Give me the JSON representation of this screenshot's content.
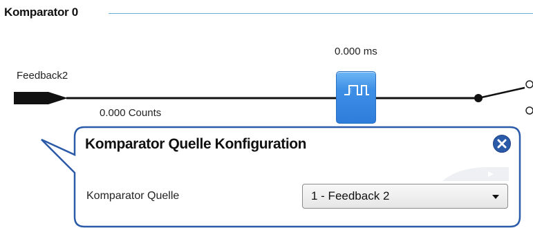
{
  "section": {
    "title": "Komparator 0"
  },
  "diagram": {
    "timing_value": "0.000 ms",
    "signal_label": "Feedback2",
    "counts_value": "0.000 Counts",
    "block_icon": "pulse-waveform-icon",
    "switch_icon": "switch-icon"
  },
  "popup": {
    "title": "Komparator Quelle Konfiguration",
    "close_icon": "close-icon",
    "field_label": "Komparator Quelle",
    "select_value": "1 - Feedback 2",
    "select_arrow_icon": "chevron-down-icon"
  },
  "colors": {
    "accent_blue": "#3d8fe6",
    "popup_border": "#2a5aa8",
    "rule_blue": "#6aaedc"
  }
}
